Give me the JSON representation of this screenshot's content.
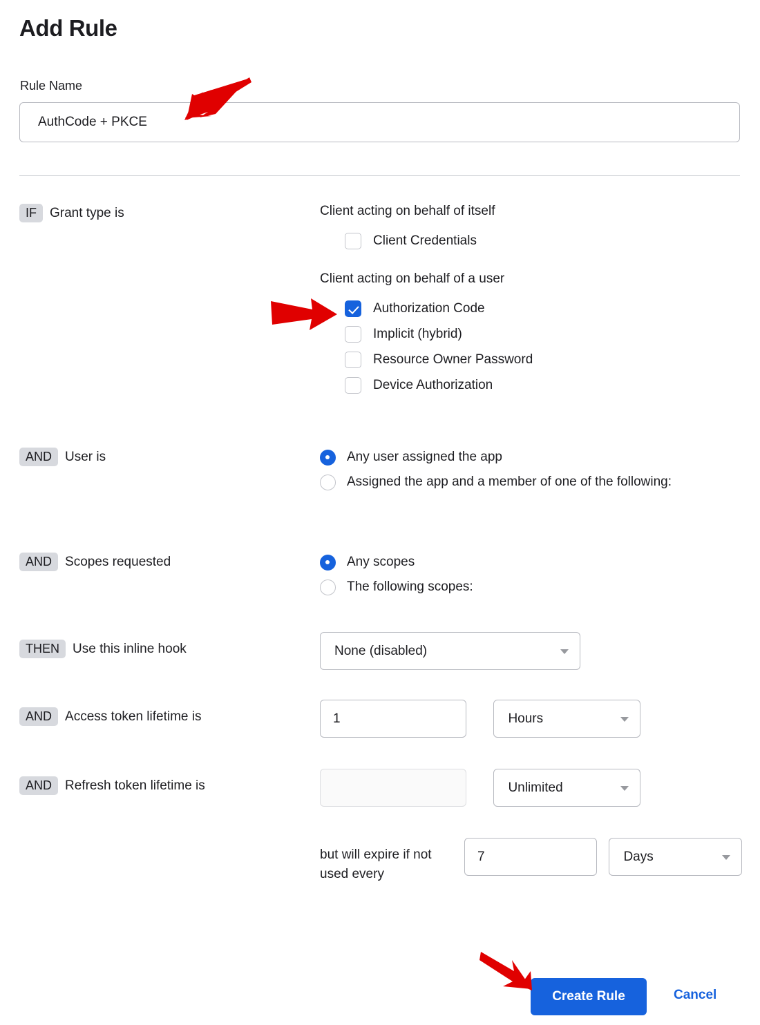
{
  "page": {
    "title": "Add Rule"
  },
  "rule_name": {
    "label": "Rule Name",
    "value": "AuthCode + PKCE",
    "placeholder": "Rule Name"
  },
  "conditions": {
    "grant_type": {
      "badge": "IF",
      "label": "Grant type is",
      "group_self": {
        "heading": "Client acting on behalf of itself",
        "options": [
          {
            "label": "Client Credentials",
            "checked": false
          }
        ]
      },
      "group_user": {
        "heading": "Client acting on behalf of a user",
        "options": [
          {
            "label": "Authorization Code",
            "checked": true
          },
          {
            "label": "Implicit (hybrid)",
            "checked": false
          },
          {
            "label": "Resource Owner Password",
            "checked": false
          },
          {
            "label": "Device Authorization",
            "checked": false
          }
        ]
      }
    },
    "user_is": {
      "badge": "AND",
      "label": "User is",
      "options": [
        {
          "label": "Any user assigned the app",
          "selected": true
        },
        {
          "label": "Assigned the app and a member of one of the following:",
          "selected": false
        }
      ]
    },
    "scopes_requested": {
      "badge": "AND",
      "label": "Scopes requested",
      "options": [
        {
          "label": "Any scopes",
          "selected": true
        },
        {
          "label": "The following scopes:",
          "selected": false
        }
      ]
    }
  },
  "actions": {
    "inline_hook": {
      "badge": "THEN",
      "label": "Use this inline hook",
      "selected": "None (disabled)"
    },
    "access_token_lifetime": {
      "badge": "AND",
      "label": "Access token lifetime is",
      "amount": "1",
      "unit": "Hours"
    },
    "refresh_token_lifetime": {
      "badge": "AND",
      "label": "Refresh token lifetime is",
      "amount": "",
      "unit": "Unlimited"
    },
    "refresh_expiry": {
      "text": "but will expire if not used every",
      "amount": "7",
      "unit": "Days"
    }
  },
  "footer": {
    "primary_label": "Create Rule",
    "cancel_label": "Cancel"
  },
  "colors": {
    "accent": "#1662dd",
    "badge_bg": "#d7d9de",
    "border": "#b7b9c0",
    "annotation": "#e00000"
  },
  "annotations": [
    {
      "name": "arrow-to-rule-name-input",
      "direction": "down-left"
    },
    {
      "name": "arrow-to-authorization-code-checkbox",
      "direction": "right"
    },
    {
      "name": "arrow-to-create-rule-button",
      "direction": "down-right"
    }
  ]
}
